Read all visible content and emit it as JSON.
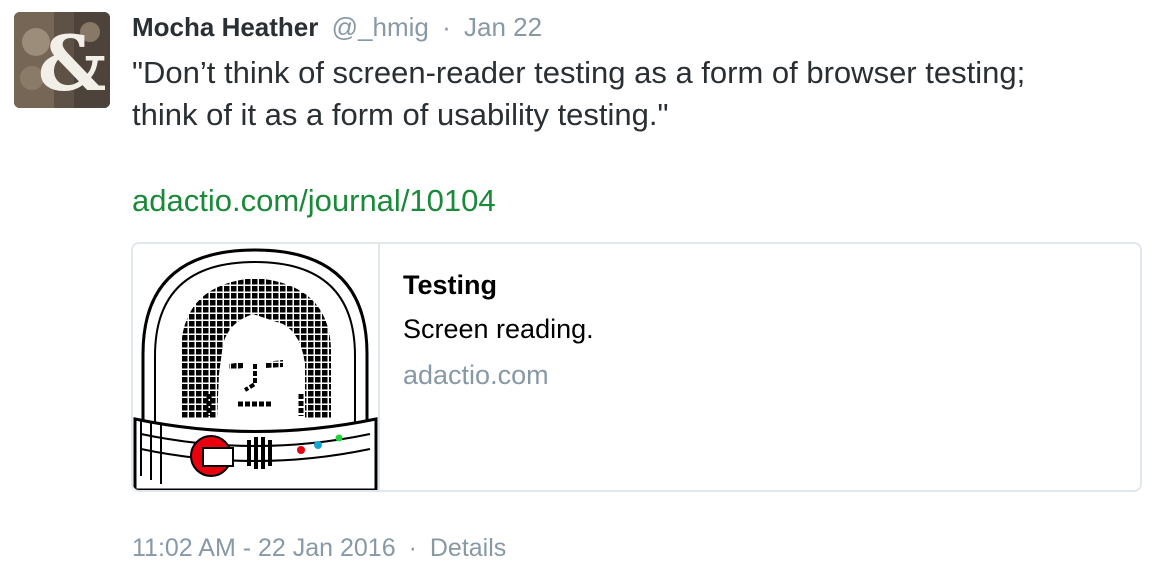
{
  "author": {
    "name": "Mocha Heather",
    "handle": "@_hmig",
    "separator": "·",
    "date": "Jan 22",
    "avatar_icon": "ampersand-avatar"
  },
  "tweet": {
    "text_line_1": "\"Don’t think of screen-reader testing as a form of browser testing;",
    "text_line_2": "think of it as a form of usability testing.\"",
    "link": "adactio.com/journal/10104",
    "link_color": "#1a8a3a"
  },
  "card": {
    "image_icon": "astronaut-helmet-icon",
    "title": "Testing",
    "description": "Screen reading.",
    "domain": "adactio.com"
  },
  "footer": {
    "timestamp": "11:02 AM - 22 Jan 2016",
    "separator": "·",
    "details_label": "Details"
  }
}
